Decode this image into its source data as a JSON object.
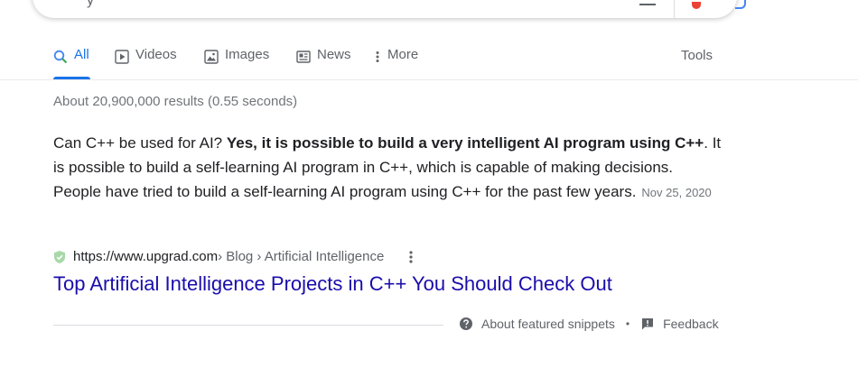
{
  "tabs": [
    {
      "label": "All",
      "icon": "search-icon"
    },
    {
      "label": "Videos",
      "icon": "play-icon"
    },
    {
      "label": "Images",
      "icon": "image-icon"
    },
    {
      "label": "News",
      "icon": "news-icon"
    },
    {
      "label": "More",
      "icon": "more-vertical-icon"
    }
  ],
  "tools_label": "Tools",
  "result_stats": "About 20,900,000 results (0.55 seconds)",
  "snippet": {
    "question": "Can C++ be used for AI? ",
    "answer_bold": "Yes, it is possible to build a very intelligent AI program using C++",
    "rest": ". It is possible to build a self-learning AI program in C++, which is capable of making decisions. People have tried to build a self-learning AI program using C++ for the past few years.",
    "date": "Nov 25, 2020"
  },
  "result": {
    "url": "https://www.upgrad.com",
    "breadcrumb": " › Blog › Artificial Intelligence",
    "title": "Top Artificial Intelligence Projects in C++ You Should Check Out"
  },
  "footer": {
    "about_label": "About featured snippets",
    "separator": "•",
    "feedback_label": "Feedback"
  },
  "colors": {
    "accent": "#1a73e8",
    "link": "#1a0dab",
    "muted": "#70757a"
  }
}
